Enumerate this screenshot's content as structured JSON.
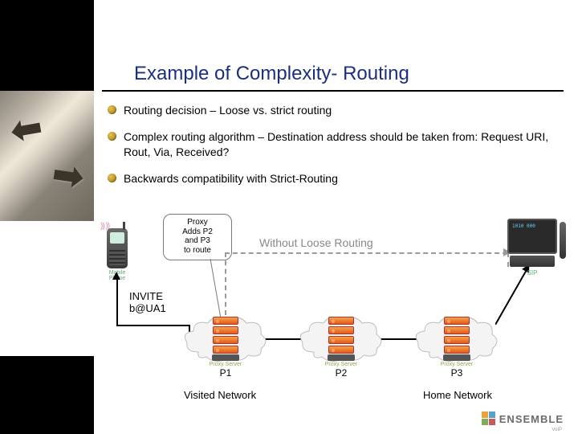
{
  "title": "Example of Complexity- Routing",
  "bullets": [
    "Routing decision – Loose vs. strict routing",
    "Complex routing algorithm – Destination address should be taken from: Request URI, Rout, Via, Received?",
    "Backwards compatibility with Strict-Routing"
  ],
  "callout": {
    "l1": "Proxy",
    "l2": "Adds P2",
    "l3": "and P3",
    "l4": "to route"
  },
  "without_loose_routing": "Without Loose Routing",
  "invite_line1": "INVITE",
  "invite_line2": "b@UA1",
  "phone_label": "Mobile Phone",
  "videophone_label": "SIP",
  "videophone_screen": "1010 000",
  "nodes": {
    "proxy_sub": "Proxy\nServer",
    "p1": "P1",
    "p2": "P2",
    "p3": "P3"
  },
  "visited_network": "Visited Network",
  "home_network": "Home Network",
  "logo_text": "ENSEMBLE",
  "logo_sub": "VoIP"
}
